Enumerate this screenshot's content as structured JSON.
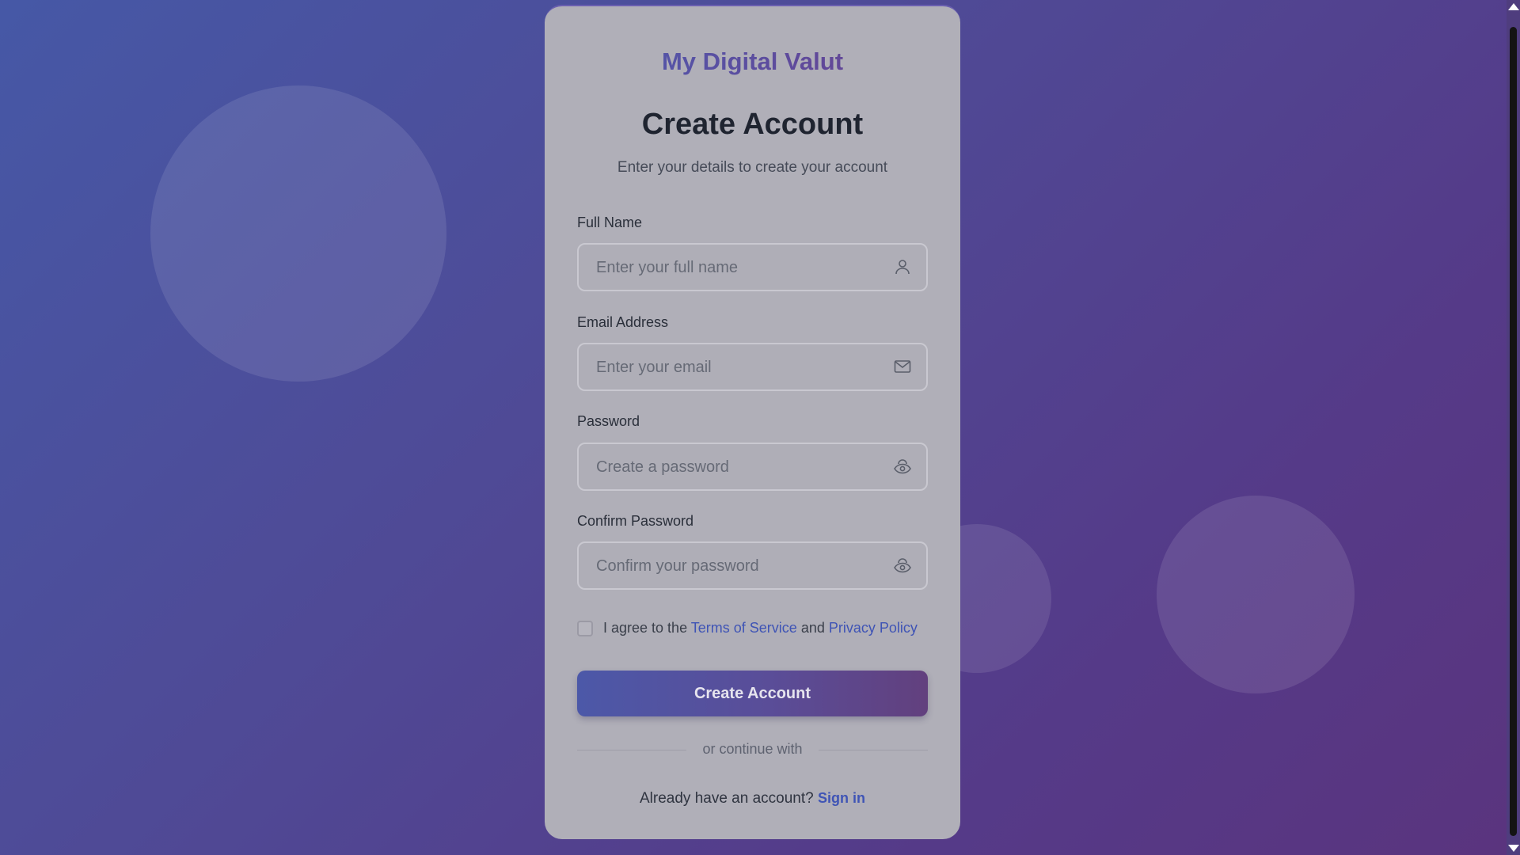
{
  "app": {
    "brand": "My Digital Valut",
    "title": "Create Account",
    "subtitle": "Enter your details to create your account"
  },
  "form": {
    "full_name": {
      "label": "Full Name",
      "placeholder": "Enter your full name",
      "icon": "user-icon"
    },
    "email": {
      "label": "Email Address",
      "placeholder": "Enter your email",
      "icon": "mail-icon"
    },
    "password": {
      "label": "Password",
      "placeholder": "Create a password",
      "icon": "eye-icon"
    },
    "confirm_password": {
      "label": "Confirm Password",
      "placeholder": "Confirm your password",
      "icon": "eye-icon"
    },
    "terms": {
      "prefix": "I agree to the",
      "terms_link": "Terms of Service",
      "and": "and",
      "privacy_link": "Privacy Policy",
      "checked": false
    },
    "submit_label": "Create Account"
  },
  "divider": {
    "label": "or continue with"
  },
  "footer": {
    "prompt": "Already have an account?",
    "signin_label": "Sign in"
  },
  "colors": {
    "accent": "#3f54b5",
    "button_start": "#4c58a8",
    "button_end": "#62407e"
  }
}
